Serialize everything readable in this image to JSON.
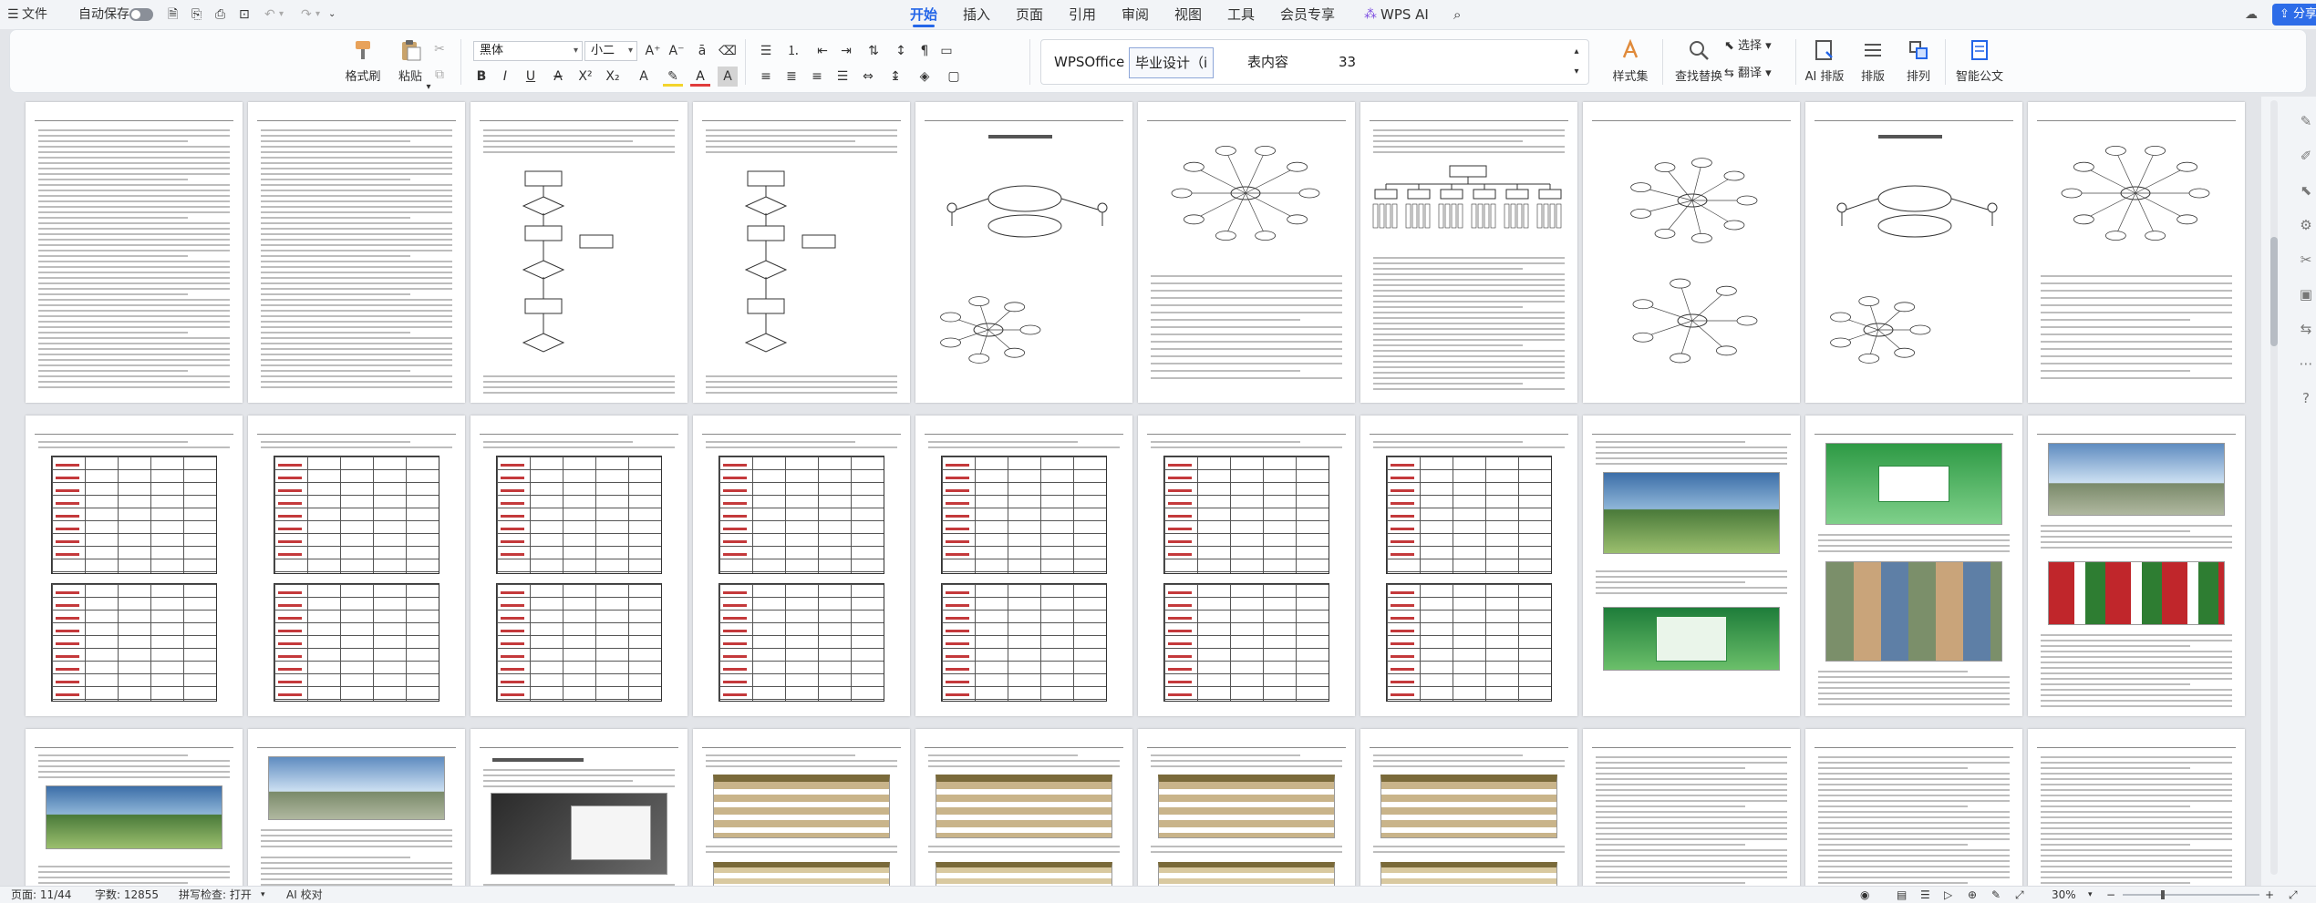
{
  "menubar": {
    "menu_icon": "hamburger-icon",
    "file_label": "文件",
    "autosave_label": "自动保存",
    "tabs": [
      {
        "label": "开始",
        "active": true
      },
      {
        "label": "插入"
      },
      {
        "label": "页面"
      },
      {
        "label": "引用"
      },
      {
        "label": "审阅"
      },
      {
        "label": "视图"
      },
      {
        "label": "工具"
      },
      {
        "label": "会员专享"
      },
      {
        "label": "WPS AI"
      }
    ],
    "share_label": "分享"
  },
  "ribbon": {
    "format_painter": "格式刷",
    "paste": "粘贴",
    "font_name": "黑体",
    "font_size": "小二",
    "styles": [
      "WPSOffice 手",
      "毕业设计（i",
      "表内容",
      "33"
    ],
    "style_set": "样式集",
    "find_replace": "查找替换",
    "select": "选择",
    "translate": "翻译",
    "ai_layout": "AI 排版",
    "layout": "排版",
    "arrange": "排列",
    "smart_doc": "智能公文"
  },
  "statusbar": {
    "page": "页面: 11/44",
    "words": "字数: 12855",
    "spellcheck": "拼写检查: 打开",
    "ai_check": "AI 校对",
    "zoom": "30%"
  },
  "colors": {
    "accent": "#2466e8",
    "ui_bg": "#f2f4f7",
    "doc_bg": "#e3e5e9"
  }
}
